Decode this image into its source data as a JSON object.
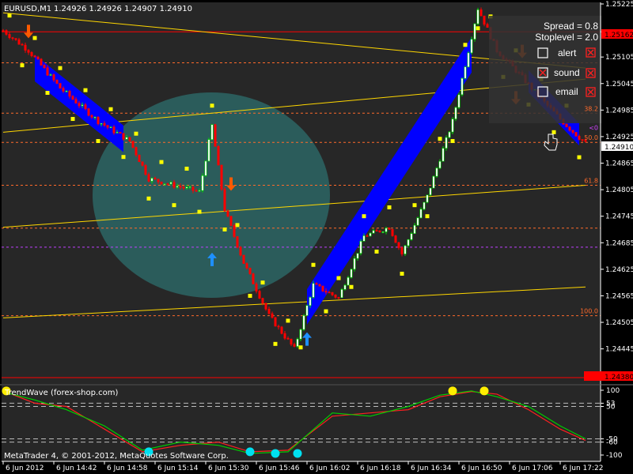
{
  "header": {
    "symbol": "EURUSD,M1",
    "ohlc": "1.24926 1.24926 1.24907 1.24910"
  },
  "colors": {
    "background": "#000000",
    "main_plot_bg": "#272727",
    "candle_up": "#00e000",
    "candle_down": "#ff0000",
    "dots": "#ffff00",
    "channel": "#0000ff",
    "circle": "#2e6f6e",
    "trend_line": "#ffd700",
    "fib_line": "#ff6a2a",
    "red_line": "#ff0000",
    "arrow_down": "#ff5a00",
    "arrow_up": "#1e90ff",
    "indicator_red": "#ff2020",
    "indicator_green": "#00d000",
    "indicator_dot_yellow": "#ffee00",
    "indicator_dot_cyan": "#00e0f0"
  },
  "info_panel": {
    "spread": "Spread = 0.8",
    "stoplevel": "Stoplevel = 2.0",
    "options": [
      {
        "label": "alert"
      },
      {
        "label": "sound"
      },
      {
        "label": "email"
      }
    ]
  },
  "fib_labels": [
    "38.2",
    "50.0",
    "61.8",
    "100.0",
    "<0"
  ],
  "price_tags": {
    "red_top": "1.25162",
    "current": "1.24910",
    "red_bottom": "1.24380"
  },
  "indicator": {
    "name": "TrendWave (forex-shop.com)",
    "levels": [
      "100",
      "53",
      "50",
      "-50",
      "-60",
      "-100"
    ],
    "level_values": [
      100,
      60,
      50,
      -50,
      -60,
      -100
    ],
    "ylim": [
      -100,
      100
    ]
  },
  "copyright": "MetaTrader 4, © 2001-2012, MetaQuotes Software Corp.",
  "chart_data": {
    "type": "line",
    "title": "EURUSD,M1",
    "ylim": [
      1.2438,
      1.25225
    ],
    "y_ticks": [
      "1.25225",
      "1.25162",
      "1.25105",
      "1.25045",
      "1.24985",
      "1.24925",
      "1.24865",
      "1.24805",
      "1.24745",
      "1.24685",
      "1.24625",
      "1.24565",
      "1.24505",
      "1.24445",
      "1.24380"
    ],
    "y_tick_values": [
      1.25225,
      1.25162,
      1.25105,
      1.25045,
      1.24985,
      1.24925,
      1.24865,
      1.24805,
      1.24745,
      1.24685,
      1.24625,
      1.24565,
      1.24505,
      1.24445,
      1.2438
    ],
    "x_ticks": [
      "6 Jun 2012",
      "6 Jun 14:42",
      "6 Jun 14:58",
      "6 Jun 15:14",
      "6 Jun 15:30",
      "6 Jun 15:46",
      "6 Jun 16:02",
      "6 Jun 16:18",
      "6 Jun 16:34",
      "6 Jun 16:50",
      "6 Jun 17:06",
      "6 Jun 17:22"
    ],
    "x_tick_index": [
      0,
      16,
      32,
      48,
      64,
      80,
      96,
      112,
      128,
      144,
      160,
      176
    ],
    "bars_total": 185,
    "price_path": [
      [
        0,
        1.25165
      ],
      [
        8,
        1.2512
      ],
      [
        18,
        1.25035
      ],
      [
        30,
        1.2496
      ],
      [
        40,
        1.24915
      ],
      [
        46,
        1.2483
      ],
      [
        54,
        1.24815
      ],
      [
        62,
        1.248
      ],
      [
        66,
        1.2495
      ],
      [
        70,
        1.2476
      ],
      [
        76,
        1.2464
      ],
      [
        84,
        1.2452
      ],
      [
        92,
        1.24445
      ],
      [
        98,
        1.2459
      ],
      [
        106,
        1.2456
      ],
      [
        114,
        1.247
      ],
      [
        122,
        1.2472
      ],
      [
        126,
        1.2466
      ],
      [
        134,
        1.2479
      ],
      [
        142,
        1.2496
      ],
      [
        150,
        1.25215
      ],
      [
        156,
        1.2512
      ],
      [
        162,
        1.25075
      ],
      [
        170,
        1.2501
      ],
      [
        178,
        1.2495
      ],
      [
        184,
        1.2491
      ]
    ],
    "fib_levels": [
      {
        "label": "38.2",
        "value": 1.24978
      },
      {
        "label": "50.0",
        "value": 1.24912
      },
      {
        "label": "61.8",
        "value": 1.24815
      },
      {
        "label": "100.0",
        "value": 1.2452
      },
      {
        "label": "<0",
        "value": 1.24935
      }
    ],
    "red_levels": [
      1.25162,
      1.2438
    ],
    "dashed_levels": [
      1.25092,
      1.24718,
      1.24675
    ],
    "trend_lines": [
      {
        "from": [
          0,
          1.25205
        ],
        "to": [
          184,
          1.2508
        ]
      },
      {
        "from": [
          0,
          1.24935
        ],
        "to": [
          184,
          1.25055
        ]
      },
      {
        "from": [
          0,
          1.2472
        ],
        "to": [
          184,
          1.24815
        ]
      },
      {
        "from": [
          0,
          1.24515
        ],
        "to": [
          184,
          1.24585
        ]
      }
    ],
    "channels": [
      {
        "from": [
          10,
          1.2508
        ],
        "to": [
          38,
          1.2492
        ],
        "width": 0.0003
      },
      {
        "from": [
          96,
          1.2454
        ],
        "to": [
          148,
          1.2511
        ],
        "width": 0.0004
      },
      {
        "from": [
          166,
          1.2505
        ],
        "to": [
          182,
          1.2493
        ],
        "width": 0.00025
      }
    ],
    "arrows_down": [
      [
        8,
        1.2516
      ],
      [
        72,
        1.24815
      ],
      [
        164,
        1.25115
      ],
      [
        162,
        1.2501
      ]
    ],
    "arrows_up": [
      [
        66,
        1.2465
      ],
      [
        96,
        1.2447
      ]
    ],
    "indicator_series": {
      "red": [
        [
          0,
          98
        ],
        [
          10,
          60
        ],
        [
          20,
          50
        ],
        [
          32,
          -20
        ],
        [
          44,
          -90
        ],
        [
          56,
          -70
        ],
        [
          68,
          -60
        ],
        [
          78,
          -90
        ],
        [
          90,
          -85
        ],
        [
          104,
          20
        ],
        [
          116,
          30
        ],
        [
          128,
          40
        ],
        [
          138,
          80
        ],
        [
          148,
          96
        ],
        [
          156,
          88
        ],
        [
          166,
          40
        ],
        [
          176,
          -20
        ],
        [
          184,
          -55
        ]
      ],
      "green": [
        [
          0,
          95
        ],
        [
          10,
          70
        ],
        [
          20,
          40
        ],
        [
          32,
          -10
        ],
        [
          44,
          -85
        ],
        [
          56,
          -60
        ],
        [
          68,
          -70
        ],
        [
          78,
          -95
        ],
        [
          90,
          -90
        ],
        [
          104,
          30
        ],
        [
          116,
          20
        ],
        [
          128,
          50
        ],
        [
          138,
          85
        ],
        [
          148,
          98
        ],
        [
          156,
          80
        ],
        [
          166,
          50
        ],
        [
          176,
          -10
        ],
        [
          184,
          -50
        ]
      ],
      "dots_yellow": [
        [
          1,
          98
        ],
        [
          142,
          98
        ],
        [
          152,
          98
        ]
      ],
      "dots_cyan": [
        [
          46,
          -90
        ],
        [
          78,
          -90
        ],
        [
          86,
          -95
        ],
        [
          93,
          -95
        ]
      ]
    }
  }
}
